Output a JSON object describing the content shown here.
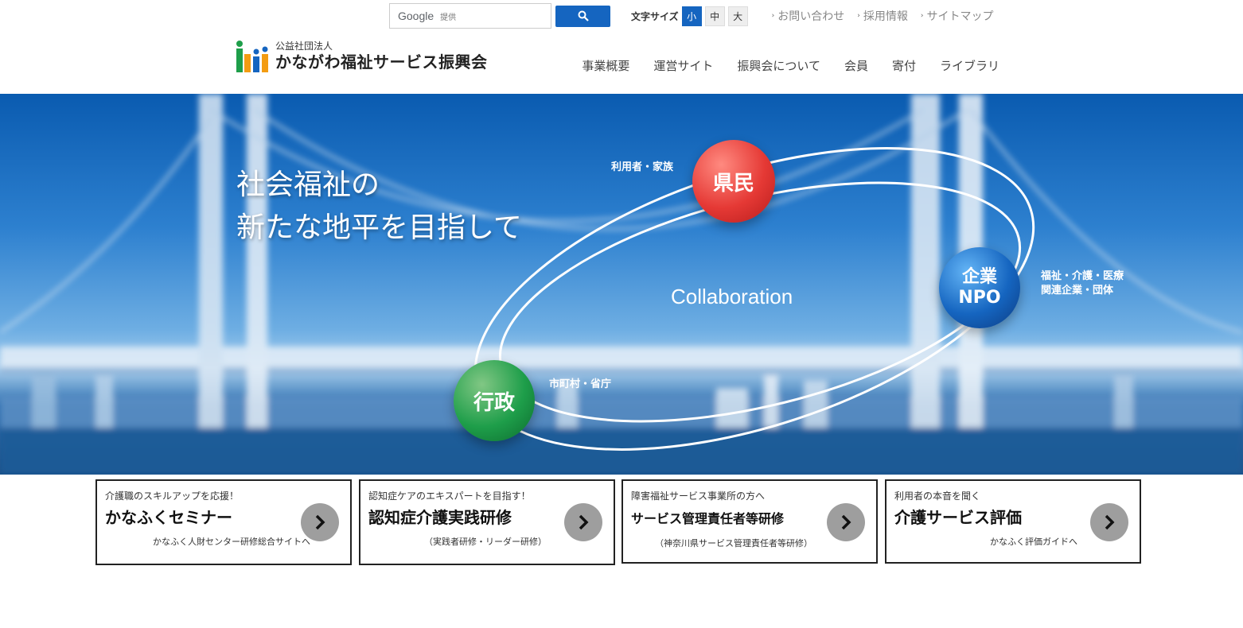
{
  "search": {
    "brand": "Google",
    "sub": "提供"
  },
  "font_size": {
    "label": "文字サイズ",
    "options": [
      "小",
      "中",
      "大"
    ],
    "selected": "小"
  },
  "util_links": [
    "お問い合わせ",
    "採用情報",
    "サイトマップ"
  ],
  "logo": {
    "sub": "公益社団法人",
    "main": "かながわ福祉サービス振興会"
  },
  "nav": [
    "事業概要",
    "運営サイト",
    "振興会について",
    "会員",
    "寄付",
    "ライブラリ"
  ],
  "hero": {
    "title_line1": "社会福祉の",
    "title_line2": "新たな地平を目指して",
    "collaboration": "Collaboration",
    "kenmin": "県民",
    "kenmin_label": "利用者・家族",
    "kigyo_line1": "企業",
    "kigyo_line2": "NPO",
    "kigyo_label_line1": "福祉・介護・医療",
    "kigyo_label_line2": "関連企業・団体",
    "gyosei": "行政",
    "gyosei_label": "市町村・省庁"
  },
  "cards": [
    {
      "pre": "介護職のスキルアップを応援！",
      "title": "かなふくセミナー",
      "sub": "かなふく人財センター研修総合サイトへ"
    },
    {
      "pre": "認知症ケアのエキスパートを目指す！",
      "title": "認知症介護実践研修",
      "sub": "（実践者研修・リーダー研修）"
    },
    {
      "pre": "障害福祉サービス事業所の方へ",
      "title": "サービス管理責任者等研修",
      "sub": "（神奈川県サービス管理責任者等研修）"
    },
    {
      "pre": "利用者の本音を聞く",
      "title": "介護サービス評価",
      "sub": "かなふく評価ガイドへ"
    }
  ],
  "colors": {
    "accent": "#1565c0",
    "kenmin": "#e53935",
    "kigyo": "#0d47a1",
    "gyosei": "#1e9e4a"
  }
}
